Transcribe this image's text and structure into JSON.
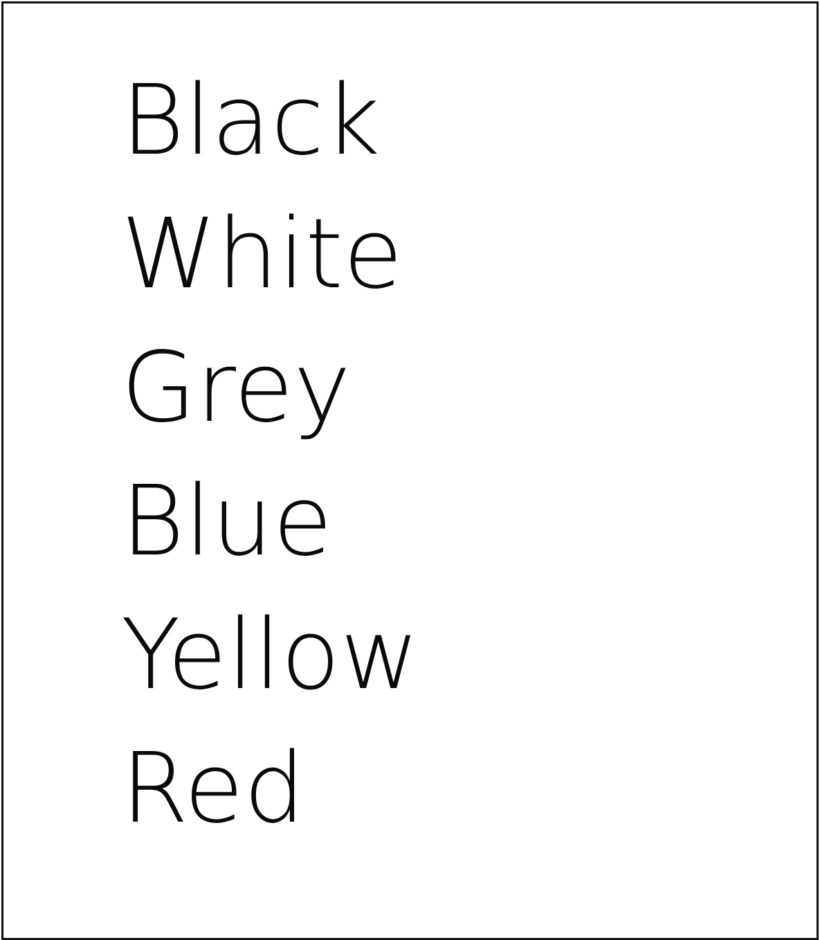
{
  "document": {
    "words": [
      "Black",
      "White",
      "Grey",
      "Blue",
      "Yellow",
      "Red"
    ]
  },
  "colors": {
    "text": "#0a0a0a",
    "border": "#111111",
    "background": "#ffffff"
  }
}
